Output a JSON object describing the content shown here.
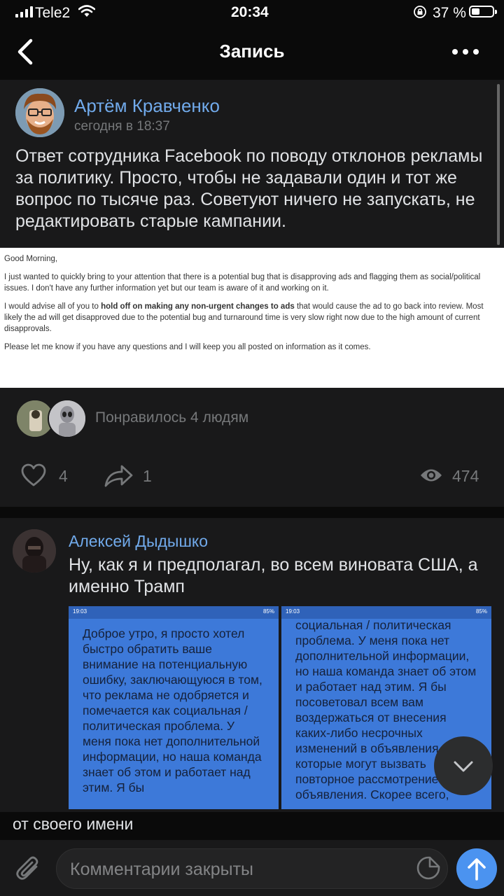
{
  "status_bar": {
    "carrier": "Tele2",
    "time": "20:34",
    "battery": "37 %"
  },
  "nav": {
    "title": "Запись"
  },
  "post": {
    "author": "Артём Кравченко",
    "time": "сегодня в 18:37",
    "text": "Ответ сотрудника Facebook по поводу отклонов рекламы за политику. Просто, чтобы не задавали один и тот же вопрос по тысяче раз. Советуют ничего не запускать, не редактировать старые кампании.",
    "image": {
      "greeting": "Good Morning,",
      "p1": "I just wanted to quickly bring to your attention that there is a potential bug that is disapproving ads and flagging them as social/political issues. I don't have any further information yet but our team is aware of it and working on it.",
      "p2_pre": "I would advise all of you to ",
      "p2_bold": "hold off on making any non-urgent changes to ads",
      "p2_post": " that would cause the ad to go back into review. Most likely the ad will get disapproved due to the potential bug and turnaround time is very slow right now due to the high amount of current disapprovals.",
      "p3": "Please let me know if you have any questions and I will keep you all posted on information as it comes."
    },
    "likes_text": "Понравилось 4 людям",
    "like_count": "4",
    "share_count": "1",
    "views": "474"
  },
  "comment": {
    "author": "Алексей Дыдышко",
    "text": "Ну, как я и предполагал, во всем виновата США, а именно Трамп",
    "shot_time": "19:03",
    "shot_battery": "85%",
    "shot_left_text": "Доброе утро, я просто хотел быстро обратить ваше внимание на потенциальную ошибку, заключающуюся в том, что реклама не одобряется и помечается как социальная / политическая проблема.  У меня пока нет дополнительной информации, но наша команда знает об этом и работает над этим.  Я бы",
    "shot_right_text": "социальная / политическая проблема.  У меня пока нет дополнительной информации, но наша команда знает об этом и работает над этим.  Я бы посоветовал всем вам воздержаться от внесения каких-либо несрочных изменений в объявления, которые могут вызвать повторное рассмотрение объявления.  Скорее всего,",
    "continued": "от своего имени"
  },
  "bottom": {
    "input_placeholder": "Комментарии закрыты"
  },
  "colors": {
    "accent": "#71aaeb",
    "send_button": "#4b93f0",
    "card": "#19191a",
    "background": "#0a0a0a"
  }
}
